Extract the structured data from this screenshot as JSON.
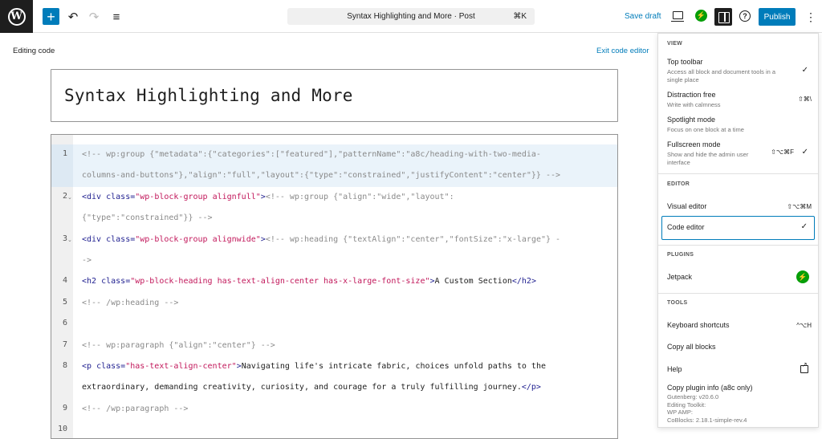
{
  "topbar": {
    "logo_letter": "W",
    "add_glyph": "+",
    "undo_glyph": "↶",
    "redo_glyph": "↷",
    "outline_glyph": "≡",
    "command_text": "Syntax Highlighting and More · Post",
    "command_shortcut": "⌘K",
    "save_draft": "Save draft",
    "jetpack_glyph": "⚡",
    "help_glyph": "?",
    "publish": "Publish",
    "kebab": "⋮",
    "icons": [
      "wordpress-icon",
      "plus-icon",
      "undo-icon",
      "redo-icon",
      "list-view-icon",
      "desktop-preview-icon",
      "jetpack-icon",
      "settings-sidebar-icon",
      "help-icon",
      "more-options-icon"
    ]
  },
  "editor": {
    "editing_label": "Editing code",
    "exit_label": "Exit code editor",
    "title": "Syntax Highlighting and More",
    "lines": [
      {
        "num": "1",
        "fold": "",
        "rows": [
          [
            [
              "c",
              "<!-- wp:group {\"metadata\":{\"categories\":[\"featured\"],\"patternName\":\"a8c/heading-with-two-media-"
            ]
          ],
          [
            [
              "c",
              "columns-and-buttons\"},\"align\":\"full\",\"layout\":{\"type\":\"constrained\",\"justifyContent\":\"center\"}} -->"
            ]
          ]
        ]
      },
      {
        "num": "2",
        "fold": "⌄",
        "rows": [
          [
            [
              "t",
              "<div "
            ],
            [
              "a",
              "class="
            ],
            [
              "s",
              "\"wp-block-group alignfull\""
            ],
            [
              "t",
              ">"
            ],
            [
              "c",
              "<!-- wp:group {\"align\":\"wide\",\"layout\":"
            ]
          ],
          [
            [
              "c",
              "{\"type\":\"constrained\"}} -->"
            ]
          ]
        ]
      },
      {
        "num": "3",
        "fold": "⌄",
        "rows": [
          [
            [
              "t",
              "<div "
            ],
            [
              "a",
              "class="
            ],
            [
              "s",
              "\"wp-block-group alignwide\""
            ],
            [
              "t",
              ">"
            ],
            [
              "c",
              "<!-- wp:heading {\"textAlign\":\"center\",\"fontSize\":\"x-large\"} -"
            ]
          ],
          [
            [
              "c",
              "->"
            ]
          ]
        ]
      },
      {
        "num": "4",
        "fold": "",
        "rows": [
          [
            [
              "t",
              "<h2 "
            ],
            [
              "a",
              "class="
            ],
            [
              "s",
              "\"wp-block-heading has-text-align-center has-x-large-font-size\""
            ],
            [
              "t",
              ">"
            ],
            [
              "x",
              "A Custom Section"
            ],
            [
              "t",
              "</h2>"
            ]
          ]
        ]
      },
      {
        "num": "5",
        "fold": "",
        "rows": [
          [
            [
              "c",
              "<!-- /wp:heading -->"
            ]
          ]
        ]
      },
      {
        "num": "6",
        "fold": "",
        "rows": [
          [
            [
              "x",
              ""
            ]
          ]
        ]
      },
      {
        "num": "7",
        "fold": "",
        "rows": [
          [
            [
              "c",
              "<!-- wp:paragraph {\"align\":\"center\"} -->"
            ]
          ]
        ]
      },
      {
        "num": "8",
        "fold": "",
        "rows": [
          [
            [
              "t",
              "<p "
            ],
            [
              "a",
              "class="
            ],
            [
              "s",
              "\"has-text-align-center\""
            ],
            [
              "t",
              ">"
            ],
            [
              "x",
              "Navigating life's intricate fabric, choices unfold paths to the"
            ]
          ],
          [
            [
              "x",
              "extraordinary, demanding creativity, curiosity, and courage for a truly fulfilling journey."
            ],
            [
              "t",
              "</p>"
            ]
          ]
        ]
      },
      {
        "num": "9",
        "fold": "",
        "rows": [
          [
            [
              "c",
              "<!-- /wp:paragraph -->"
            ]
          ]
        ]
      },
      {
        "num": "10",
        "fold": "",
        "rows": [
          [
            [
              "x",
              ""
            ]
          ]
        ]
      }
    ]
  },
  "menu": {
    "view_heading": "VIEW",
    "top_toolbar": {
      "label": "Top toolbar",
      "desc": "Access all block and document tools in a single place",
      "check": "✓"
    },
    "distraction_free": {
      "label": "Distraction free",
      "desc": "Write with calmness",
      "shortcut": "⇧⌘\\"
    },
    "spotlight": {
      "label": "Spotlight mode",
      "desc": "Focus on one block at a time"
    },
    "fullscreen": {
      "label": "Fullscreen mode",
      "desc": "Show and hide the admin user interface",
      "shortcut": "⇧⌥⌘F",
      "check": "✓"
    },
    "editor_heading": "EDITOR",
    "visual_editor": {
      "label": "Visual editor",
      "shortcut": "⇧⌥⌘M"
    },
    "code_editor": {
      "label": "Code editor",
      "check": "✓"
    },
    "plugins_heading": "PLUGINS",
    "jetpack": {
      "label": "Jetpack",
      "glyph": "⚡"
    },
    "tools_heading": "TOOLS",
    "keyboard_shortcuts": {
      "label": "Keyboard shortcuts",
      "shortcut": "^⌥H"
    },
    "copy_all_blocks": {
      "label": "Copy all blocks"
    },
    "help": {
      "label": "Help"
    },
    "copy_plugin_info": {
      "label": "Copy plugin info (a8c only)",
      "desc": "Gutenberg: v20.6.0\nEditing Toolkit:\nWP AMP:\nCoBlocks: 2.18.1-simple-rev.4"
    }
  }
}
